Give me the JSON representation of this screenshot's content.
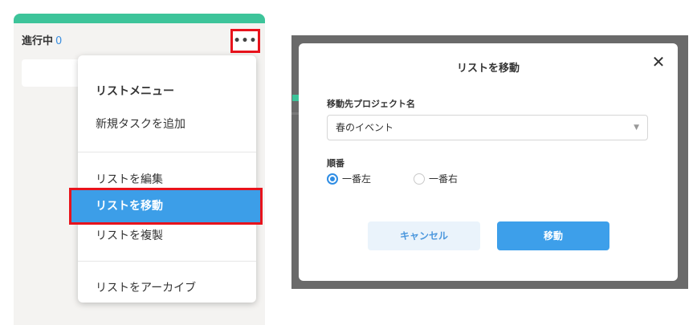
{
  "column": {
    "title": "進行中",
    "count": "0",
    "menu_trigger": "•••"
  },
  "menu": {
    "title": "リストメニュー",
    "items": [
      {
        "label": "新規タスクを追加"
      },
      {
        "label": "リストを編集"
      },
      {
        "label": "リストを移動",
        "highlighted": true
      },
      {
        "label": "リストを複製"
      },
      {
        "label": "リストをアーカイブ"
      }
    ]
  },
  "dialog": {
    "title": "リストを移動",
    "close": "✕",
    "project_label": "移動先プロジェクト名",
    "project_value": "春のイベント",
    "order_label": "順番",
    "order_options": [
      {
        "label": "一番左",
        "checked": true
      },
      {
        "label": "一番右",
        "checked": false
      }
    ],
    "cancel_label": "キャンセル",
    "move_label": "移動"
  },
  "colors": {
    "accent_green": "#3dc49a",
    "accent_blue": "#3d9fea",
    "highlight_red": "#e8131c"
  }
}
